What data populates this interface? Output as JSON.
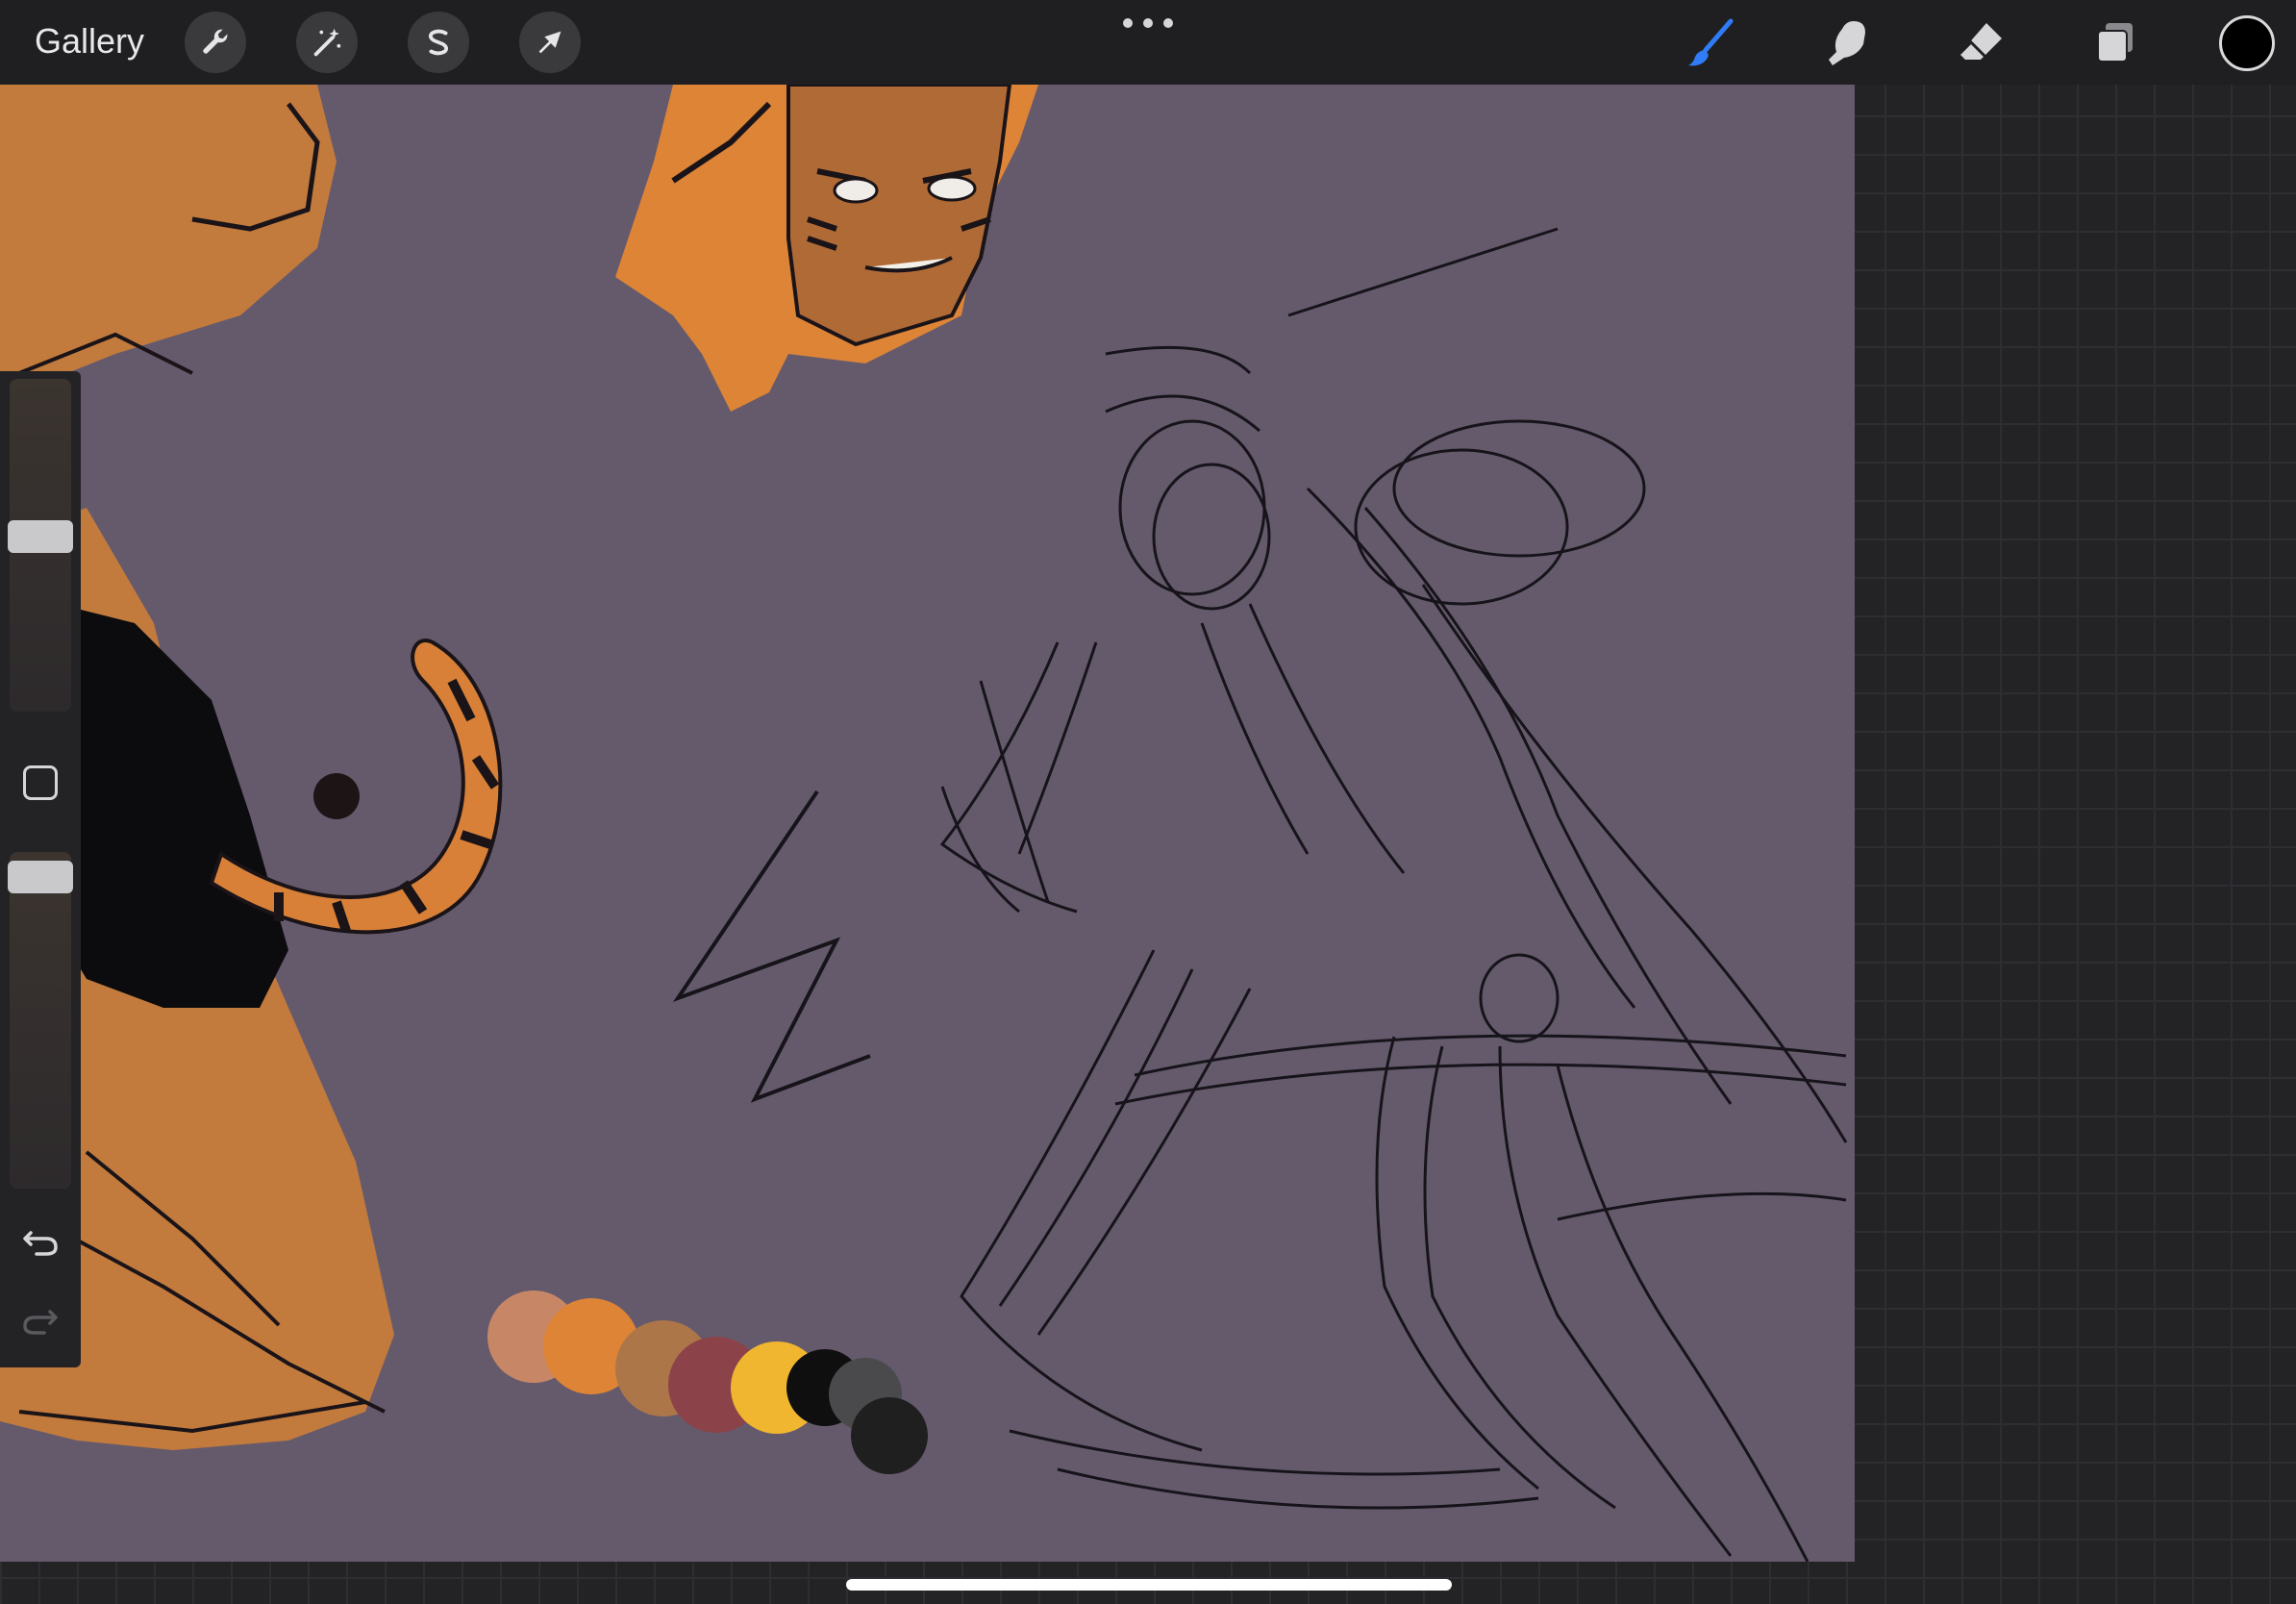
{
  "toolbar": {
    "gallery_label": "Gallery",
    "left_tools": [
      {
        "name": "actions",
        "icon": "wrench-icon"
      },
      {
        "name": "adjustments",
        "icon": "magic-wand-icon"
      },
      {
        "name": "selection",
        "icon": "selection-s-icon"
      },
      {
        "name": "transform",
        "icon": "arrow-cursor-icon"
      }
    ],
    "more_icon": "more-dots-icon",
    "right_tools": [
      {
        "name": "brush",
        "icon": "brush-icon",
        "active": true,
        "color": "#2f7cf6"
      },
      {
        "name": "smudge",
        "icon": "smudge-finger-icon"
      },
      {
        "name": "eraser",
        "icon": "eraser-icon"
      },
      {
        "name": "layers",
        "icon": "layers-icon"
      }
    ],
    "current_color": "#000000"
  },
  "sidebar": {
    "brush_size_level": 0.53,
    "opacity_level": 0.97,
    "modify_icon": "square-modify-icon",
    "undo_icon": "undo-icon",
    "redo_icon": "redo-icon"
  },
  "canvas": {
    "background_color": "#655a6c",
    "palette_dots": [
      "#c78766",
      "#de8436",
      "#ad7649",
      "#8b4349",
      "#f0b630",
      "#0f0f10",
      "#4a4a4c",
      "#1f1f20"
    ]
  }
}
